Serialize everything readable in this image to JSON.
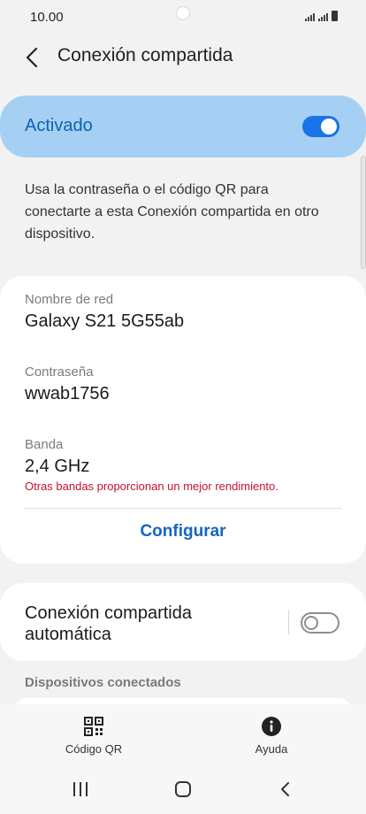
{
  "status_bar": {
    "time": "10.00"
  },
  "header": {
    "title": "Conexión compartida",
    "back_icon": "chevron-left-icon"
  },
  "main_toggle": {
    "label": "Activado",
    "state": "on",
    "accent": "#1a73e8"
  },
  "description": "Usa la contraseña o el código QR para conectarte a esta Conexión compartida en otro dispositivo.",
  "network": {
    "name_label": "Nombre de red",
    "name_value": "Galaxy S21 5G55ab",
    "password_label": "Contraseña",
    "password_value": "wwab1756",
    "band_label": "Banda",
    "band_value": "2,4 GHz",
    "band_note": "Otras bandas proporcionan un mejor rendimiento.",
    "configure_label": "Configurar"
  },
  "auto_hotspot": {
    "label": "Conexión compartida automática",
    "state": "off"
  },
  "connected_devices": {
    "header": "Dispositivos conectados"
  },
  "bottom_actions": {
    "qr": {
      "label": "Código QR",
      "icon": "qr-code-icon"
    },
    "help": {
      "label": "Ayuda",
      "icon": "info-icon"
    }
  },
  "colors": {
    "accent": "#1a73e8",
    "toggle_card_bg": "#a6d0f3",
    "warning": "#c8102e",
    "link": "#1565c0"
  }
}
